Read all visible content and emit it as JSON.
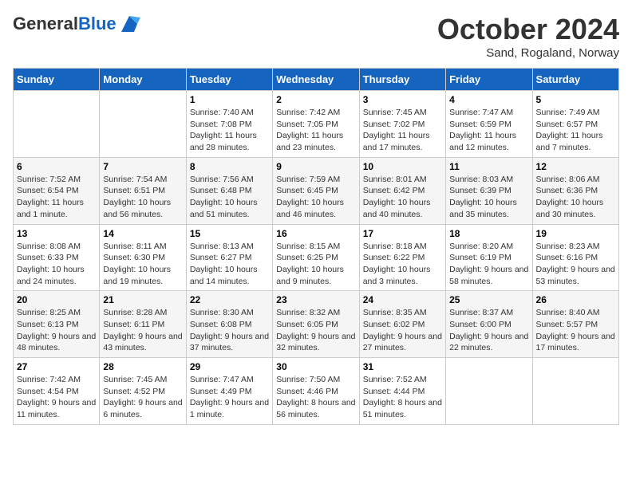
{
  "header": {
    "logo_line1": "General",
    "logo_line2": "Blue",
    "month": "October 2024",
    "location": "Sand, Rogaland, Norway"
  },
  "weekdays": [
    "Sunday",
    "Monday",
    "Tuesday",
    "Wednesday",
    "Thursday",
    "Friday",
    "Saturday"
  ],
  "weeks": [
    [
      {
        "day": "",
        "sunrise": "",
        "sunset": "",
        "daylight": ""
      },
      {
        "day": "",
        "sunrise": "",
        "sunset": "",
        "daylight": ""
      },
      {
        "day": "1",
        "sunrise": "Sunrise: 7:40 AM",
        "sunset": "Sunset: 7:08 PM",
        "daylight": "Daylight: 11 hours and 28 minutes."
      },
      {
        "day": "2",
        "sunrise": "Sunrise: 7:42 AM",
        "sunset": "Sunset: 7:05 PM",
        "daylight": "Daylight: 11 hours and 23 minutes."
      },
      {
        "day": "3",
        "sunrise": "Sunrise: 7:45 AM",
        "sunset": "Sunset: 7:02 PM",
        "daylight": "Daylight: 11 hours and 17 minutes."
      },
      {
        "day": "4",
        "sunrise": "Sunrise: 7:47 AM",
        "sunset": "Sunset: 6:59 PM",
        "daylight": "Daylight: 11 hours and 12 minutes."
      },
      {
        "day": "5",
        "sunrise": "Sunrise: 7:49 AM",
        "sunset": "Sunset: 6:57 PM",
        "daylight": "Daylight: 11 hours and 7 minutes."
      }
    ],
    [
      {
        "day": "6",
        "sunrise": "Sunrise: 7:52 AM",
        "sunset": "Sunset: 6:54 PM",
        "daylight": "Daylight: 11 hours and 1 minute."
      },
      {
        "day": "7",
        "sunrise": "Sunrise: 7:54 AM",
        "sunset": "Sunset: 6:51 PM",
        "daylight": "Daylight: 10 hours and 56 minutes."
      },
      {
        "day": "8",
        "sunrise": "Sunrise: 7:56 AM",
        "sunset": "Sunset: 6:48 PM",
        "daylight": "Daylight: 10 hours and 51 minutes."
      },
      {
        "day": "9",
        "sunrise": "Sunrise: 7:59 AM",
        "sunset": "Sunset: 6:45 PM",
        "daylight": "Daylight: 10 hours and 46 minutes."
      },
      {
        "day": "10",
        "sunrise": "Sunrise: 8:01 AM",
        "sunset": "Sunset: 6:42 PM",
        "daylight": "Daylight: 10 hours and 40 minutes."
      },
      {
        "day": "11",
        "sunrise": "Sunrise: 8:03 AM",
        "sunset": "Sunset: 6:39 PM",
        "daylight": "Daylight: 10 hours and 35 minutes."
      },
      {
        "day": "12",
        "sunrise": "Sunrise: 8:06 AM",
        "sunset": "Sunset: 6:36 PM",
        "daylight": "Daylight: 10 hours and 30 minutes."
      }
    ],
    [
      {
        "day": "13",
        "sunrise": "Sunrise: 8:08 AM",
        "sunset": "Sunset: 6:33 PM",
        "daylight": "Daylight: 10 hours and 24 minutes."
      },
      {
        "day": "14",
        "sunrise": "Sunrise: 8:11 AM",
        "sunset": "Sunset: 6:30 PM",
        "daylight": "Daylight: 10 hours and 19 minutes."
      },
      {
        "day": "15",
        "sunrise": "Sunrise: 8:13 AM",
        "sunset": "Sunset: 6:27 PM",
        "daylight": "Daylight: 10 hours and 14 minutes."
      },
      {
        "day": "16",
        "sunrise": "Sunrise: 8:15 AM",
        "sunset": "Sunset: 6:25 PM",
        "daylight": "Daylight: 10 hours and 9 minutes."
      },
      {
        "day": "17",
        "sunrise": "Sunrise: 8:18 AM",
        "sunset": "Sunset: 6:22 PM",
        "daylight": "Daylight: 10 hours and 3 minutes."
      },
      {
        "day": "18",
        "sunrise": "Sunrise: 8:20 AM",
        "sunset": "Sunset: 6:19 PM",
        "daylight": "Daylight: 9 hours and 58 minutes."
      },
      {
        "day": "19",
        "sunrise": "Sunrise: 8:23 AM",
        "sunset": "Sunset: 6:16 PM",
        "daylight": "Daylight: 9 hours and 53 minutes."
      }
    ],
    [
      {
        "day": "20",
        "sunrise": "Sunrise: 8:25 AM",
        "sunset": "Sunset: 6:13 PM",
        "daylight": "Daylight: 9 hours and 48 minutes."
      },
      {
        "day": "21",
        "sunrise": "Sunrise: 8:28 AM",
        "sunset": "Sunset: 6:11 PM",
        "daylight": "Daylight: 9 hours and 43 minutes."
      },
      {
        "day": "22",
        "sunrise": "Sunrise: 8:30 AM",
        "sunset": "Sunset: 6:08 PM",
        "daylight": "Daylight: 9 hours and 37 minutes."
      },
      {
        "day": "23",
        "sunrise": "Sunrise: 8:32 AM",
        "sunset": "Sunset: 6:05 PM",
        "daylight": "Daylight: 9 hours and 32 minutes."
      },
      {
        "day": "24",
        "sunrise": "Sunrise: 8:35 AM",
        "sunset": "Sunset: 6:02 PM",
        "daylight": "Daylight: 9 hours and 27 minutes."
      },
      {
        "day": "25",
        "sunrise": "Sunrise: 8:37 AM",
        "sunset": "Sunset: 6:00 PM",
        "daylight": "Daylight: 9 hours and 22 minutes."
      },
      {
        "day": "26",
        "sunrise": "Sunrise: 8:40 AM",
        "sunset": "Sunset: 5:57 PM",
        "daylight": "Daylight: 9 hours and 17 minutes."
      }
    ],
    [
      {
        "day": "27",
        "sunrise": "Sunrise: 7:42 AM",
        "sunset": "Sunset: 4:54 PM",
        "daylight": "Daylight: 9 hours and 11 minutes."
      },
      {
        "day": "28",
        "sunrise": "Sunrise: 7:45 AM",
        "sunset": "Sunset: 4:52 PM",
        "daylight": "Daylight: 9 hours and 6 minutes."
      },
      {
        "day": "29",
        "sunrise": "Sunrise: 7:47 AM",
        "sunset": "Sunset: 4:49 PM",
        "daylight": "Daylight: 9 hours and 1 minute."
      },
      {
        "day": "30",
        "sunrise": "Sunrise: 7:50 AM",
        "sunset": "Sunset: 4:46 PM",
        "daylight": "Daylight: 8 hours and 56 minutes."
      },
      {
        "day": "31",
        "sunrise": "Sunrise: 7:52 AM",
        "sunset": "Sunset: 4:44 PM",
        "daylight": "Daylight: 8 hours and 51 minutes."
      },
      {
        "day": "",
        "sunrise": "",
        "sunset": "",
        "daylight": ""
      },
      {
        "day": "",
        "sunrise": "",
        "sunset": "",
        "daylight": ""
      }
    ]
  ]
}
